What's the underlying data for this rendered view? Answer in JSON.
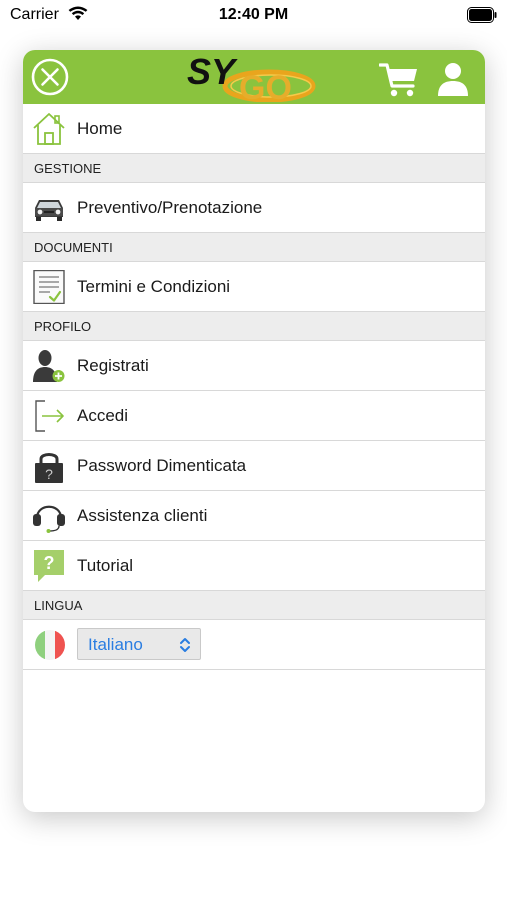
{
  "status_bar": {
    "carrier": "Carrier",
    "time": "12:40 PM"
  },
  "header": {
    "logo_text_main": "SY",
    "logo_text_overlay": "GO",
    "accent_color": "#8ac33e"
  },
  "menu": {
    "home": "Home",
    "sections": {
      "gestione": "GESTIONE",
      "documenti": "DOCUMENTI",
      "profilo": "PROFILO",
      "lingua": "LINGUA"
    },
    "preventivo": "Preventivo/Prenotazione",
    "termini": "Termini e Condizioni",
    "registrati": "Registrati",
    "accedi": "Accedi",
    "password": "Password Dimenticata",
    "assistenza": "Assistenza clienti",
    "tutorial": "Tutorial"
  },
  "language": {
    "selected": "Italiano"
  },
  "icons": {
    "home": "house-icon",
    "preventivo": "car-icon",
    "termini": "document-check-icon",
    "registrati": "user-add-icon",
    "accedi": "login-icon",
    "password": "lock-icon",
    "assistenza": "headset-icon",
    "tutorial": "help-bubble-icon",
    "lingua": "italian-flag-icon"
  }
}
